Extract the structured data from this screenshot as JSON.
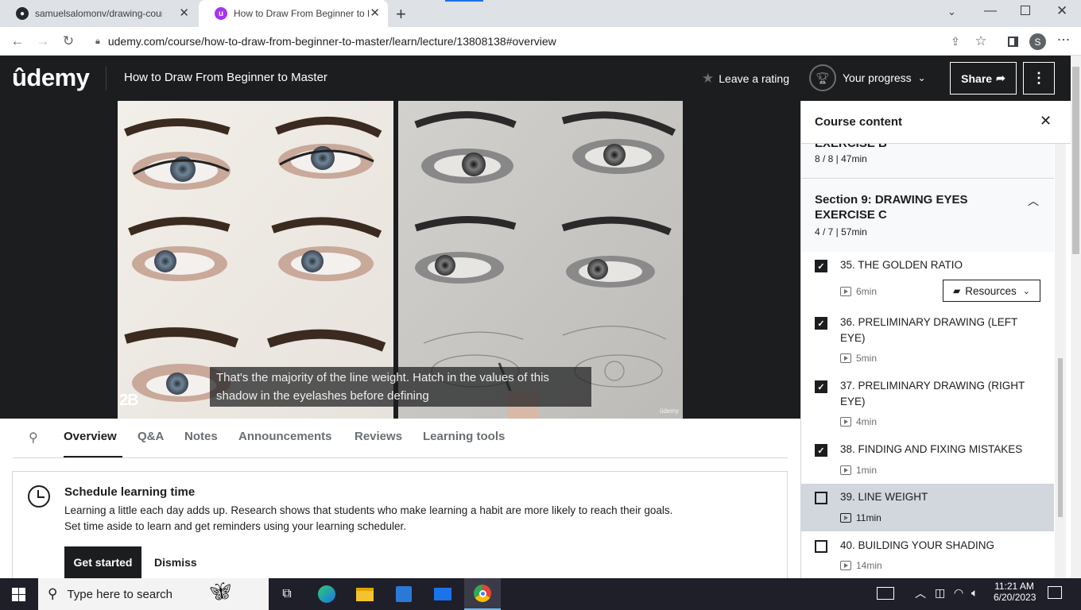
{
  "browser": {
    "tabs": [
      {
        "title": "samuelsalomonv/drawing-course",
        "favicon": "github-icon"
      },
      {
        "title": "How to Draw From Beginner to M",
        "favicon": "udemy-icon"
      }
    ],
    "url": "udemy.com/course/how-to-draw-from-beginner-to-master/learn/lecture/13808138#overview",
    "profile_initial": "S"
  },
  "header": {
    "logo": "ûdemy",
    "course_title": "How to Draw From Beginner to Master",
    "leave_rating": "Leave a rating",
    "your_progress": "Your progress",
    "share": "Share"
  },
  "video": {
    "corner_label": "2B",
    "caption_line1": "That's the majority of the line weight. Hatch in the values of this",
    "caption_line2": "shadow in the eyelashes before defining",
    "watermark": "ūdemy"
  },
  "content_tabs": [
    "Overview",
    "Q&A",
    "Notes",
    "Announcements",
    "Reviews",
    "Learning tools"
  ],
  "active_tab": "Overview",
  "schedule": {
    "title": "Schedule learning time",
    "line1": "Learning a little each day adds up. Research shows that students who make learning a habit are more likely to reach their goals.",
    "line2": "Set time aside to learn and get reminders using your learning scheduler.",
    "get_started": "Get started",
    "dismiss": "Dismiss"
  },
  "sidebar": {
    "title": "Course content",
    "prev_section_partial": "EXERCISE B",
    "prev_section_meta": "8 / 8 | 47min",
    "section_title_line1": "Section 9: DRAWING EYES",
    "section_title_line2": "EXERCISE C",
    "section_meta": "4 / 7 | 57min",
    "resources_label": "Resources",
    "lectures": [
      {
        "title": "35. THE GOLDEN RATIO",
        "title2": "",
        "duration": "6min",
        "done": true
      },
      {
        "title": "36. PRELIMINARY DRAWING (LEFT",
        "title2": "EYE)",
        "duration": "5min",
        "done": true
      },
      {
        "title": "37. PRELIMINARY DRAWING (RIGHT",
        "title2": "EYE)",
        "duration": "4min",
        "done": true
      },
      {
        "title": "38. FINDING AND FIXING MISTAKES",
        "title2": "",
        "duration": "1min",
        "done": true
      },
      {
        "title": "39. LINE WEIGHT",
        "title2": "",
        "duration": "11min",
        "done": false,
        "current": true
      },
      {
        "title": "40. BUILDING YOUR SHADING",
        "title2": "",
        "duration": "14min",
        "done": false
      }
    ]
  },
  "taskbar": {
    "search_placeholder": "Type here to search",
    "time": "11:21 AM",
    "date": "6/20/2023"
  },
  "colors": {
    "udemy_dark": "#1c1d1f",
    "udemy_purple": "#a435f0",
    "current_row": "#d1d7dc"
  }
}
